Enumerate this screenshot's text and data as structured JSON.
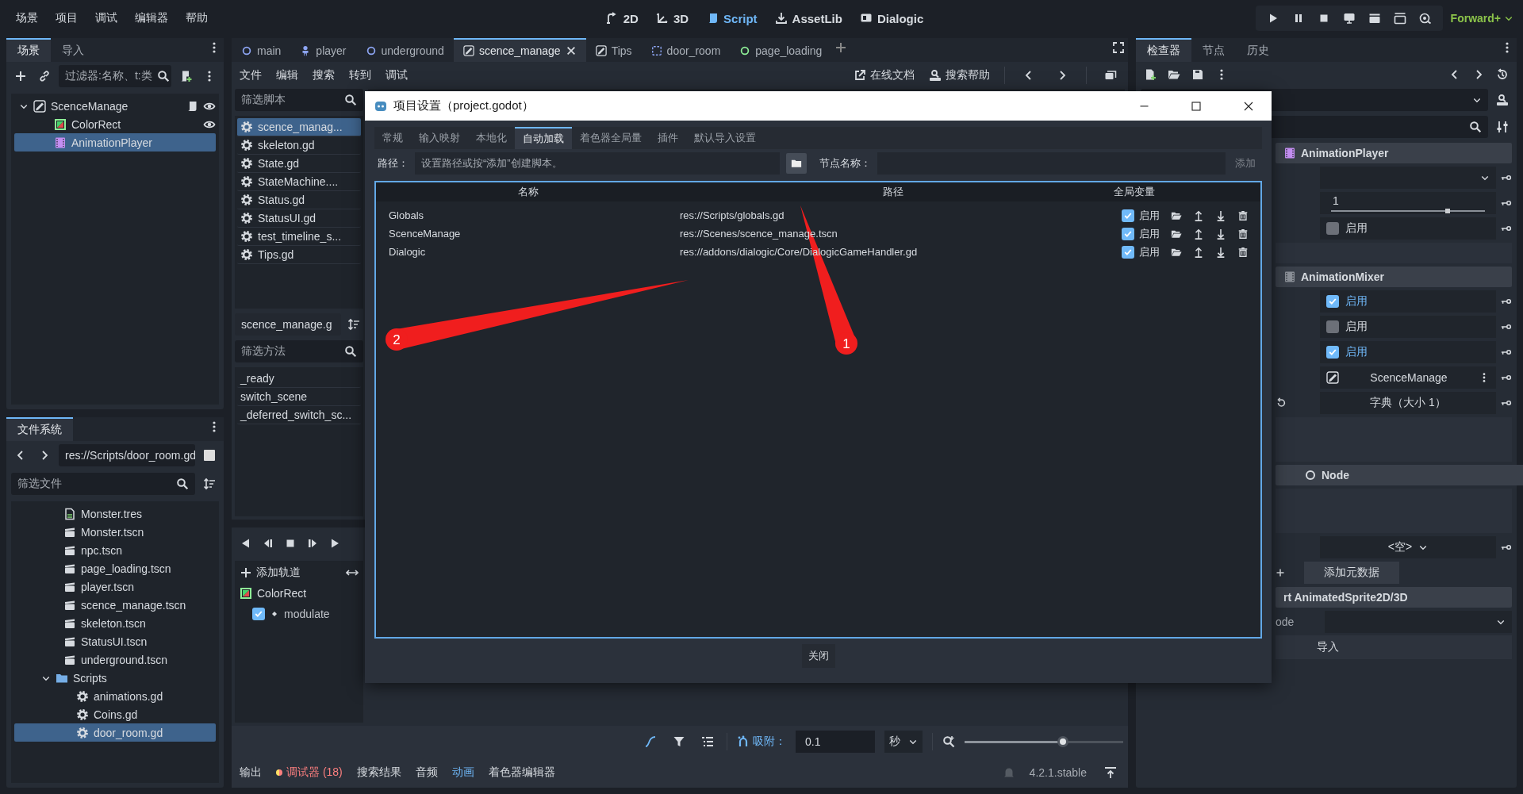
{
  "menu": [
    "场景",
    "项目",
    "调试",
    "编辑器",
    "帮助"
  ],
  "modes": [
    {
      "label": "2D",
      "kind": "canvas",
      "selected": false
    },
    {
      "label": "3D",
      "kind": "spatial",
      "selected": false
    },
    {
      "label": "Script",
      "kind": "script",
      "selected": true
    },
    {
      "label": "AssetLib",
      "kind": "assetlib",
      "selected": false
    },
    {
      "label": "Dialogic",
      "kind": "dialogic",
      "selected": false
    }
  ],
  "renderer": "Forward+",
  "scene_dock": {
    "tabs": [
      {
        "label": "场景",
        "selected": true
      },
      {
        "label": "导入",
        "selected": false
      }
    ],
    "filter": {
      "placeholder": "过滤器:名称、t:类"
    },
    "tree": [
      {
        "label": "ScenceManage",
        "kind": "scene",
        "expanded": true,
        "selected": false,
        "script": true,
        "visible": true,
        "children": [
          {
            "label": "ColorRect",
            "kind": "colorrect",
            "selected": false,
            "visible": true
          },
          {
            "label": "AnimationPlayer",
            "kind": "animplayer",
            "selected": true
          }
        ]
      }
    ]
  },
  "filesystem": {
    "tabs": [
      {
        "label": "文件系统",
        "selected": true
      }
    ],
    "path": "res://Scripts/door_room.gd",
    "filter": {
      "placeholder": "筛选文件"
    },
    "items": [
      {
        "label": "Monster.tres",
        "kind": "resource",
        "selected": false
      },
      {
        "label": "Monster.tscn",
        "kind": "scene",
        "selected": false
      },
      {
        "label": "npc.tscn",
        "kind": "scene",
        "selected": false
      },
      {
        "label": "page_loading.tscn",
        "kind": "scene",
        "selected": false
      },
      {
        "label": "player.tscn",
        "kind": "scene",
        "selected": false
      },
      {
        "label": "scence_manage.tscn",
        "kind": "scene",
        "selected": false
      },
      {
        "label": "skeleton.tscn",
        "kind": "scene",
        "selected": false
      },
      {
        "label": "StatusUI.tscn",
        "kind": "scene",
        "selected": false
      },
      {
        "label": "underground.tscn",
        "kind": "scene",
        "selected": false
      },
      {
        "label": "Scripts",
        "kind": "folder",
        "expanded": true,
        "selected": false,
        "children": [
          {
            "label": "animations.gd",
            "kind": "script",
            "selected": false
          },
          {
            "label": "Coins.gd",
            "kind": "script",
            "selected": false
          },
          {
            "label": "door_room.gd",
            "kind": "script",
            "selected": true
          }
        ]
      }
    ]
  },
  "script_tabs": [
    {
      "label": "main",
      "kind": "node",
      "selected": false
    },
    {
      "label": "player",
      "kind": "character",
      "selected": false
    },
    {
      "label": "underground",
      "kind": "node",
      "selected": false
    },
    {
      "label": "scence_manage",
      "kind": "scene",
      "selected": true
    },
    {
      "label": "Tips",
      "kind": "scene",
      "selected": false
    },
    {
      "label": "door_room",
      "kind": "frame",
      "selected": false
    },
    {
      "label": "page_loading",
      "kind": "node_green",
      "selected": false
    }
  ],
  "script_menu": [
    "文件",
    "编辑",
    "搜索",
    "转到",
    "调试"
  ],
  "help_links": [
    {
      "label": "在线文档",
      "kind": "external"
    },
    {
      "label": "搜索帮助",
      "kind": "doc"
    }
  ],
  "scripts": {
    "filter": {
      "placeholder": "筛选脚本"
    },
    "items": [
      {
        "label": "scence_manag...",
        "selected": true
      },
      {
        "label": "skeleton.gd",
        "selected": false
      },
      {
        "label": "State.gd",
        "selected": false
      },
      {
        "label": "StateMachine....",
        "selected": false
      },
      {
        "label": "Status.gd",
        "selected": false
      },
      {
        "label": "StatusUI.gd",
        "selected": false
      },
      {
        "label": "test_timeline_s...",
        "selected": false
      },
      {
        "label": "Tips.gd",
        "selected": false
      }
    ],
    "current": "scence_manage.g",
    "method_filter": {
      "placeholder": "筛选方法"
    },
    "methods": [
      "_ready",
      "switch_scene",
      "_deferred_switch_sc..."
    ]
  },
  "animation": {
    "add_track": "添加轨道",
    "tracks": [
      {
        "label": "ColorRect",
        "children": [
          {
            "label": "modulate",
            "checked": true
          }
        ]
      }
    ],
    "snap_label": "吸附：",
    "snap_value": "0.1",
    "unit": "秒",
    "zoom": {
      "level": 0.62
    }
  },
  "bottom_tabs": [
    {
      "label": "输出",
      "kind": "plain",
      "selected": false
    },
    {
      "label": "调试器 (18)",
      "kind": "alert",
      "selected": false
    },
    {
      "label": "搜索结果",
      "kind": "plain",
      "selected": false
    },
    {
      "label": "音频",
      "kind": "plain",
      "selected": false
    },
    {
      "label": "动画",
      "kind": "plain",
      "selected": true
    },
    {
      "label": "着色器编辑器",
      "kind": "plain",
      "selected": false
    }
  ],
  "version": "4.2.1.stable",
  "inspector": {
    "tabs": [
      {
        "label": "检查器",
        "selected": true
      },
      {
        "label": "节点",
        "selected": false
      },
      {
        "label": "历史",
        "selected": false
      }
    ],
    "rows": [
      {
        "kind": "header",
        "label": "AnimationPlayer"
      },
      {
        "kind": "dropdown"
      },
      {
        "kind": "slider",
        "value": "1",
        "level": 0.76
      },
      {
        "kind": "checkbox",
        "label": "启用",
        "checked": false
      },
      {
        "kind": "blank"
      },
      {
        "kind": "header",
        "label": "AnimationMixer"
      },
      {
        "kind": "checkbox",
        "label": "启用",
        "checked": true
      },
      {
        "kind": "checkbox",
        "label": "启用",
        "checked": false
      },
      {
        "kind": "checkbox",
        "label": "启用",
        "checked": true
      },
      {
        "kind": "resource",
        "label": "ScenceManage"
      },
      {
        "kind": "dict",
        "label": "字典（大小 1）"
      },
      {
        "kind": "blank_tall"
      },
      {
        "kind": "header",
        "label": "Node"
      },
      {
        "kind": "blank_tall"
      },
      {
        "kind": "dropdown",
        "label": "<空>"
      },
      {
        "kind": "button",
        "label": "添加元数据"
      },
      {
        "kind": "header",
        "label": "rt AnimatedSprite2D/3D"
      },
      {
        "kind": "dropdown",
        "side_label": "ode"
      },
      {
        "kind": "wide_button",
        "label": "导入"
      }
    ]
  },
  "dialog": {
    "title": "项目设置（project.godot）",
    "tabs": [
      {
        "label": "常规",
        "selected": false
      },
      {
        "label": "输入映射",
        "selected": false
      },
      {
        "label": "本地化",
        "selected": false
      },
      {
        "label": "自动加载",
        "selected": true
      },
      {
        "label": "着色器全局量",
        "selected": false
      },
      {
        "label": "插件",
        "selected": false
      },
      {
        "label": "默认导入设置",
        "selected": false
      }
    ],
    "path_label": "路径：",
    "path_placeholder": "设置路径或按“添加”创建脚本。",
    "node_label": "节点名称：",
    "add_button": {
      "label": "添加",
      "disabled": true
    },
    "columns": [
      "名称",
      "路径",
      "全局变量"
    ],
    "rows": [
      {
        "name": "Globals",
        "path": "res://Scripts/globals.gd",
        "enabled": true,
        "enabled_label": "启用"
      },
      {
        "name": "ScenceManage",
        "path": "res://Scenes/scence_manage.tscn",
        "enabled": true,
        "enabled_label": "启用"
      },
      {
        "name": "Dialogic",
        "path": "res://addons/dialogic/Core/DialogicGameHandler.gd",
        "enabled": true,
        "enabled_label": "启用"
      }
    ],
    "close": "关闭",
    "annotations": [
      "1",
      "2"
    ]
  }
}
